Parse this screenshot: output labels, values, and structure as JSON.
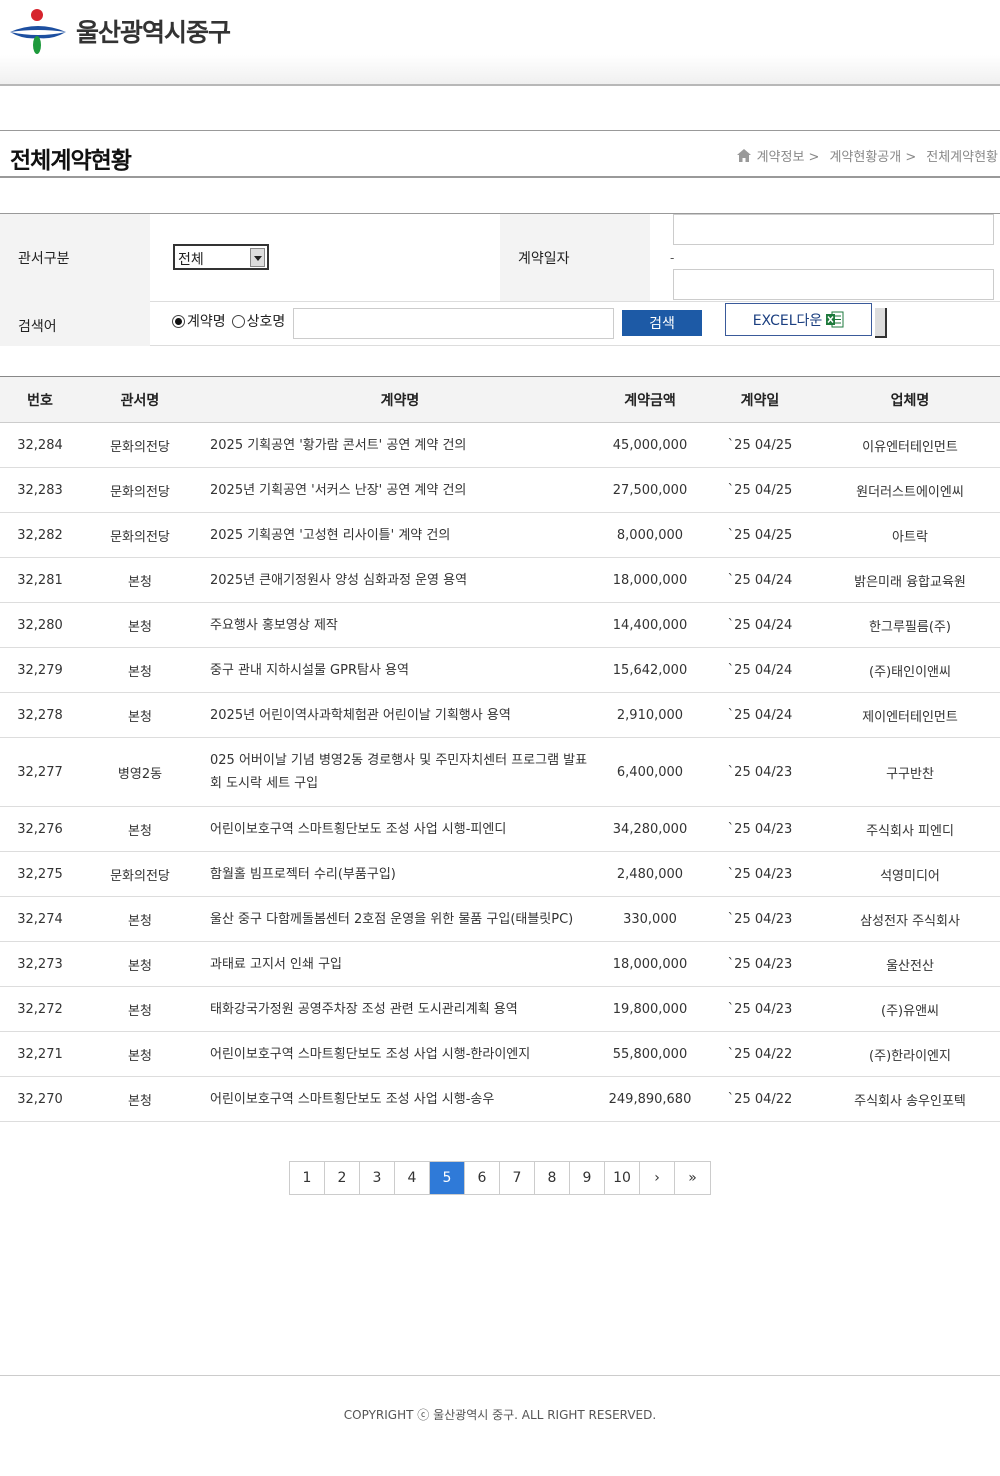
{
  "header": {
    "logo_text": "울산광역시중구"
  },
  "title_bar": {
    "title": "전체계약현황",
    "breadcrumb": [
      "계약정보 >",
      "계약현황공개 >",
      "전체계약현황"
    ]
  },
  "search": {
    "office_label": "관서구분",
    "office_selected": "전체",
    "date_label": "계약일자",
    "date_separator": "-",
    "keyword_label": "검색어",
    "radio_contract": "계약명",
    "radio_vendor": "상호명",
    "search_button": "검색",
    "excel_button": "EXCEL다운"
  },
  "table": {
    "headers": {
      "no": "번호",
      "office": "관서명",
      "name": "계약명",
      "amount": "계약금액",
      "date": "계약일",
      "vendor": "업체명"
    },
    "rows": [
      {
        "no": "32,284",
        "office": "문화의전당",
        "name": "2025 기획공연 '황가람 콘서트' 공연 계약 건의",
        "amount": "45,000,000",
        "date": "`25 04/25",
        "vendor": "이유엔터테인먼트"
      },
      {
        "no": "32,283",
        "office": "문화의전당",
        "name": "2025년 기획공연 '서커스 난장' 공연 계약 건의",
        "amount": "27,500,000",
        "date": "`25 04/25",
        "vendor": "원더러스트에이엔씨"
      },
      {
        "no": "32,282",
        "office": "문화의전당",
        "name": "2025 기획공연 '고성현 리사이틀' 계약 건의",
        "amount": "8,000,000",
        "date": "`25 04/25",
        "vendor": "아트락"
      },
      {
        "no": "32,281",
        "office": "본청",
        "name": "2025년 큰애기정원사 양성 심화과정 운영 용역",
        "amount": "18,000,000",
        "date": "`25 04/24",
        "vendor": "밝은미래 융합교육원"
      },
      {
        "no": "32,280",
        "office": "본청",
        "name": "주요행사 홍보영상 제작",
        "amount": "14,400,000",
        "date": "`25 04/24",
        "vendor": "한그루필름(주)"
      },
      {
        "no": "32,279",
        "office": "본청",
        "name": "중구 관내 지하시설물 GPR탐사 용역",
        "amount": "15,642,000",
        "date": "`25 04/24",
        "vendor": "(주)태인이앤씨"
      },
      {
        "no": "32,278",
        "office": "본청",
        "name": "2025년 어린이역사과학체험관 어린이날 기획행사 용역",
        "amount": "2,910,000",
        "date": "`25 04/24",
        "vendor": "제이엔터테인먼트"
      },
      {
        "no": "32,277",
        "office": "병영2동",
        "name": "025 어버이날 기념 병영2동 경로행사 및 주민자치센터 프로그램 발표회 도시락 세트 구입",
        "amount": "6,400,000",
        "date": "`25 04/23",
        "vendor": "구구반찬"
      },
      {
        "no": "32,276",
        "office": "본청",
        "name": "어린이보호구역 스마트횡단보도 조성 사업 시행-피엔디",
        "amount": "34,280,000",
        "date": "`25 04/23",
        "vendor": "주식회사 피엔디"
      },
      {
        "no": "32,275",
        "office": "문화의전당",
        "name": "함월홀 빔프로젝터 수리(부품구입)",
        "amount": "2,480,000",
        "date": "`25 04/23",
        "vendor": "석영미디어"
      },
      {
        "no": "32,274",
        "office": "본청",
        "name": "울산 중구 다함께돌봄센터 2호점 운영을 위한 물품 구입(태블릿PC)",
        "amount": "330,000",
        "date": "`25 04/23",
        "vendor": "삼성전자 주식회사"
      },
      {
        "no": "32,273",
        "office": "본청",
        "name": "과태료 고지서 인쇄 구입",
        "amount": "18,000,000",
        "date": "`25 04/23",
        "vendor": "울산전산"
      },
      {
        "no": "32,272",
        "office": "본청",
        "name": "태화강국가정원 공영주차장 조성 관련 도시관리계획 용역",
        "amount": "19,800,000",
        "date": "`25 04/23",
        "vendor": "(주)유앤씨"
      },
      {
        "no": "32,271",
        "office": "본청",
        "name": "어린이보호구역 스마트횡단보도 조성 사업 시행-한라이엔지",
        "amount": "55,800,000",
        "date": "`25 04/22",
        "vendor": "(주)한라이엔지"
      },
      {
        "no": "32,270",
        "office": "본청",
        "name": "어린이보호구역 스마트횡단보도 조성 사업 시행-송우",
        "amount": "249,890,680",
        "date": "`25 04/22",
        "vendor": "주식회사 송우인포텍"
      }
    ]
  },
  "pagination": {
    "pages": [
      "1",
      "2",
      "3",
      "4",
      "5",
      "6",
      "7",
      "8",
      "9",
      "10"
    ],
    "current": "5",
    "next": "›",
    "last": "»"
  },
  "footer": {
    "copyright": "COPYRIGHT ⓒ 울산광역시 중구. ALL RIGHT RESERVED."
  },
  "colors": {
    "search_button": "#1d5aa6",
    "active_page": "#2f7ad8",
    "logo_red": "#d6242d",
    "logo_blue": "#1d4fa0",
    "logo_green": "#1e9a3c"
  }
}
